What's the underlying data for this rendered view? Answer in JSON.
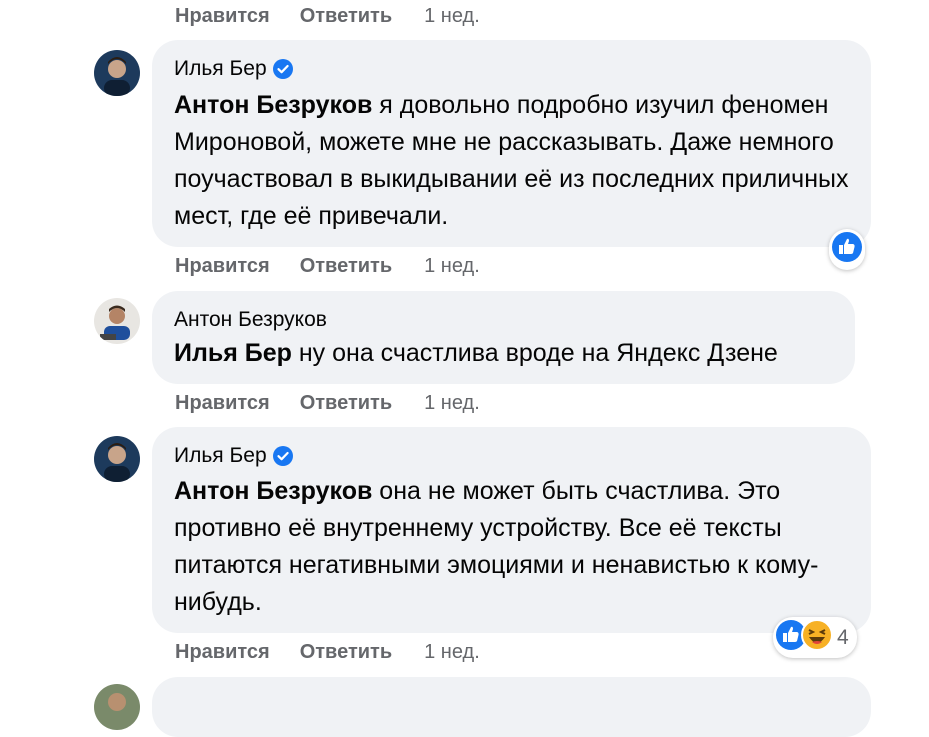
{
  "comments": [
    {
      "author": "Илья Бер",
      "verified": true,
      "mention": "Антон Безруков",
      "text": " я довольно подробно изучил феномен Мироновой, можете мне не рассказывать. Даже немного поучаствовал в выкидывании её из последних приличных мест, где её привечали.",
      "like_label": "Нравится",
      "reply_label": "Ответить",
      "time": "1 нед.",
      "reactions": [
        "like-icon"
      ]
    },
    {
      "author": "Антон Безруков",
      "verified": false,
      "mention": "Илья Бер",
      "text": " ну она счастлива вроде на Яндекс Дзене",
      "like_label": "Нравится",
      "reply_label": "Ответить",
      "time": "1 нед."
    },
    {
      "author": "Илья Бер",
      "verified": true,
      "mention": "Антон Безруков",
      "text": " она не может быть счастлива. Это противно её внутреннему устройству. Все её тексты питаются негативными эмоциями и ненавистью к кому-нибудь.",
      "like_label": "Нравится",
      "reply_label": "Ответить",
      "time": "1 нед.",
      "reactions": [
        "like-icon",
        "haha-icon"
      ],
      "reaction_count": "4"
    }
  ],
  "top_actions": {
    "like_label": "Нравится",
    "reply_label": "Ответить",
    "time": "1 нед."
  },
  "colors": {
    "bubble": "#f0f2f5",
    "meta": "#65676b",
    "accent": "#1877f2"
  }
}
